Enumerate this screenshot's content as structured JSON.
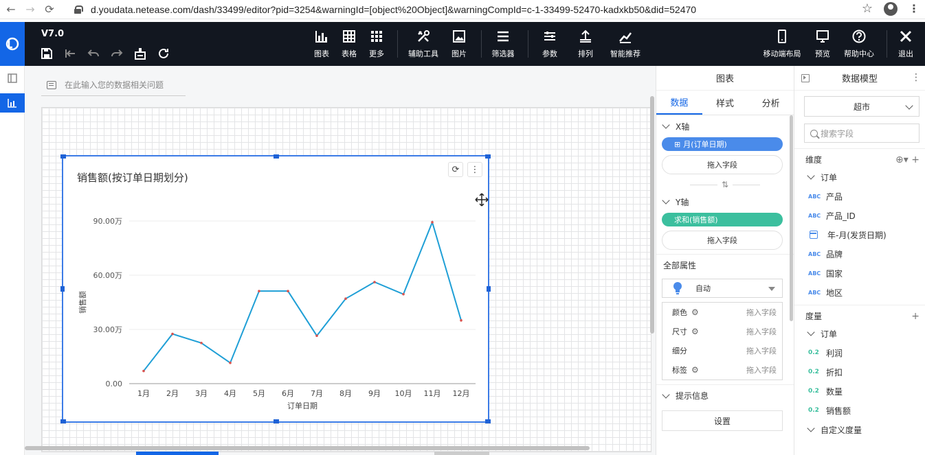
{
  "browser": {
    "url": "d.youdata.netease.com/dash/33499/editor?pid=3254&warningId=[object%20Object]&warningCompId=c-1-33499-52470-kadxkb50&did=52470"
  },
  "toolbar": {
    "version": "V7.0",
    "tools": [
      {
        "label": "图表",
        "icon": "bar-chart-icon"
      },
      {
        "label": "表格",
        "icon": "table-icon"
      },
      {
        "label": "更多",
        "icon": "grid-icon"
      },
      {
        "label": "辅助工具",
        "icon": "tools-icon"
      },
      {
        "label": "图片",
        "icon": "image-icon"
      },
      {
        "label": "筛选器",
        "icon": "filter-icon"
      },
      {
        "label": "参数",
        "icon": "param-icon"
      },
      {
        "label": "排列",
        "icon": "arrange-icon"
      },
      {
        "label": "智能推荐",
        "icon": "smart-icon"
      },
      {
        "label": "移动端布局",
        "icon": "mobile-icon"
      },
      {
        "label": "预览",
        "icon": "preview-icon"
      },
      {
        "label": "帮助中心",
        "icon": "help-icon"
      },
      {
        "label": "退出",
        "icon": "close-icon"
      }
    ]
  },
  "canvas": {
    "ask_placeholder": "在此输入您的数据相关问题"
  },
  "chart_data": {
    "type": "line",
    "title": "销售额(按订单日期划分)",
    "xlabel": "订单日期",
    "ylabel": "销售额",
    "categories": [
      "1月",
      "2月",
      "3月",
      "4月",
      "5月",
      "6月",
      "7月",
      "8月",
      "9月",
      "10月",
      "11月",
      "12月"
    ],
    "values": [
      70000,
      275000,
      225000,
      115000,
      512000,
      512000,
      265000,
      470000,
      562000,
      495000,
      893000,
      350000
    ],
    "yticks": [
      {
        "value": 0,
        "label": "0.00"
      },
      {
        "value": 300000,
        "label": "30.00万"
      },
      {
        "value": 600000,
        "label": "60.00万"
      },
      {
        "value": 900000,
        "label": "90.00万"
      }
    ],
    "ylim": [
      0,
      900000
    ],
    "grid": true,
    "color": "#1f9fd6"
  },
  "property_panel": {
    "title": "图表",
    "tabs": [
      "数据",
      "样式",
      "分析"
    ],
    "x_axis_label": "X轴",
    "x_field": "月(订单日期)",
    "drop_field": "拖入字段",
    "y_axis_label": "Y轴",
    "y_field": "求和(销售额)",
    "all_props": "全部属性",
    "auto": "自动",
    "attrs": [
      {
        "name": "颜色",
        "gear": true
      },
      {
        "name": "尺寸",
        "gear": true
      },
      {
        "name": "细分",
        "gear": false
      },
      {
        "name": "标签",
        "gear": true
      }
    ],
    "tooltip_section": "提示信息",
    "settings_button": "设置"
  },
  "model_panel": {
    "title": "数据模型",
    "dataset": "超市",
    "search_placeholder": "搜索字段",
    "dimension_group": "维度",
    "dim_folder": "订单",
    "dimensions": [
      {
        "type": "ABC",
        "name": "产品"
      },
      {
        "type": "ABC",
        "name": "产品_ID"
      },
      {
        "type": "date",
        "name": "年-月(发货日期)"
      },
      {
        "type": "ABC",
        "name": "品牌"
      },
      {
        "type": "ABC",
        "name": "国家"
      },
      {
        "type": "ABC",
        "name": "地区"
      }
    ],
    "measure_group": "度量",
    "measure_folder": "订单",
    "measures": [
      {
        "type": "0.2",
        "name": "利润"
      },
      {
        "type": "0.2",
        "name": "折扣"
      },
      {
        "type": "0.2",
        "name": "数量"
      },
      {
        "type": "0.2",
        "name": "销售额"
      }
    ],
    "custom_folder": "自定义度量"
  }
}
